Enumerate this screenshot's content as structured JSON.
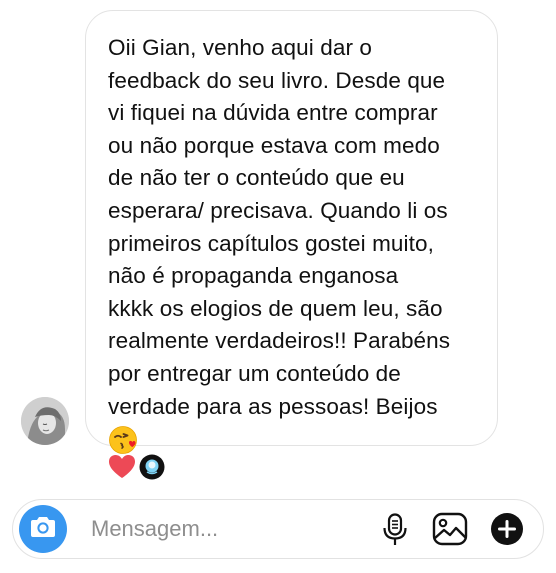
{
  "message": {
    "text": "Oii Gian, venho aqui dar o\nfeedback do seu livro. Desde que\nvi fiquei na dúvida entre comprar\nou não porque estava com medo\nde não ter o conteúdo que eu\nesperara/ precisava. Quando li os\nprimeiros capítulos gostei muito,\nnão é propaganda enganosa\nkkkk os elogios de quem leu, são\nrealmente verdadeiros!! Parabéns\npor entregar um conteúdo de\nverdade para as pessoas! Beijos",
    "emoji": "kissing-face-with-heart-emoji"
  },
  "reactions": [
    "heart-icon",
    "avatar-reaction-icon"
  ],
  "composer": {
    "placeholder": "Mensagem...",
    "icons": [
      "camera-icon",
      "microphone-icon",
      "gallery-icon",
      "plus-icon"
    ]
  },
  "colors": {
    "accent": "#3897f0",
    "heart": "#ed4956",
    "border": "#e3e3e3",
    "placeholder": "#8e8e8e"
  }
}
